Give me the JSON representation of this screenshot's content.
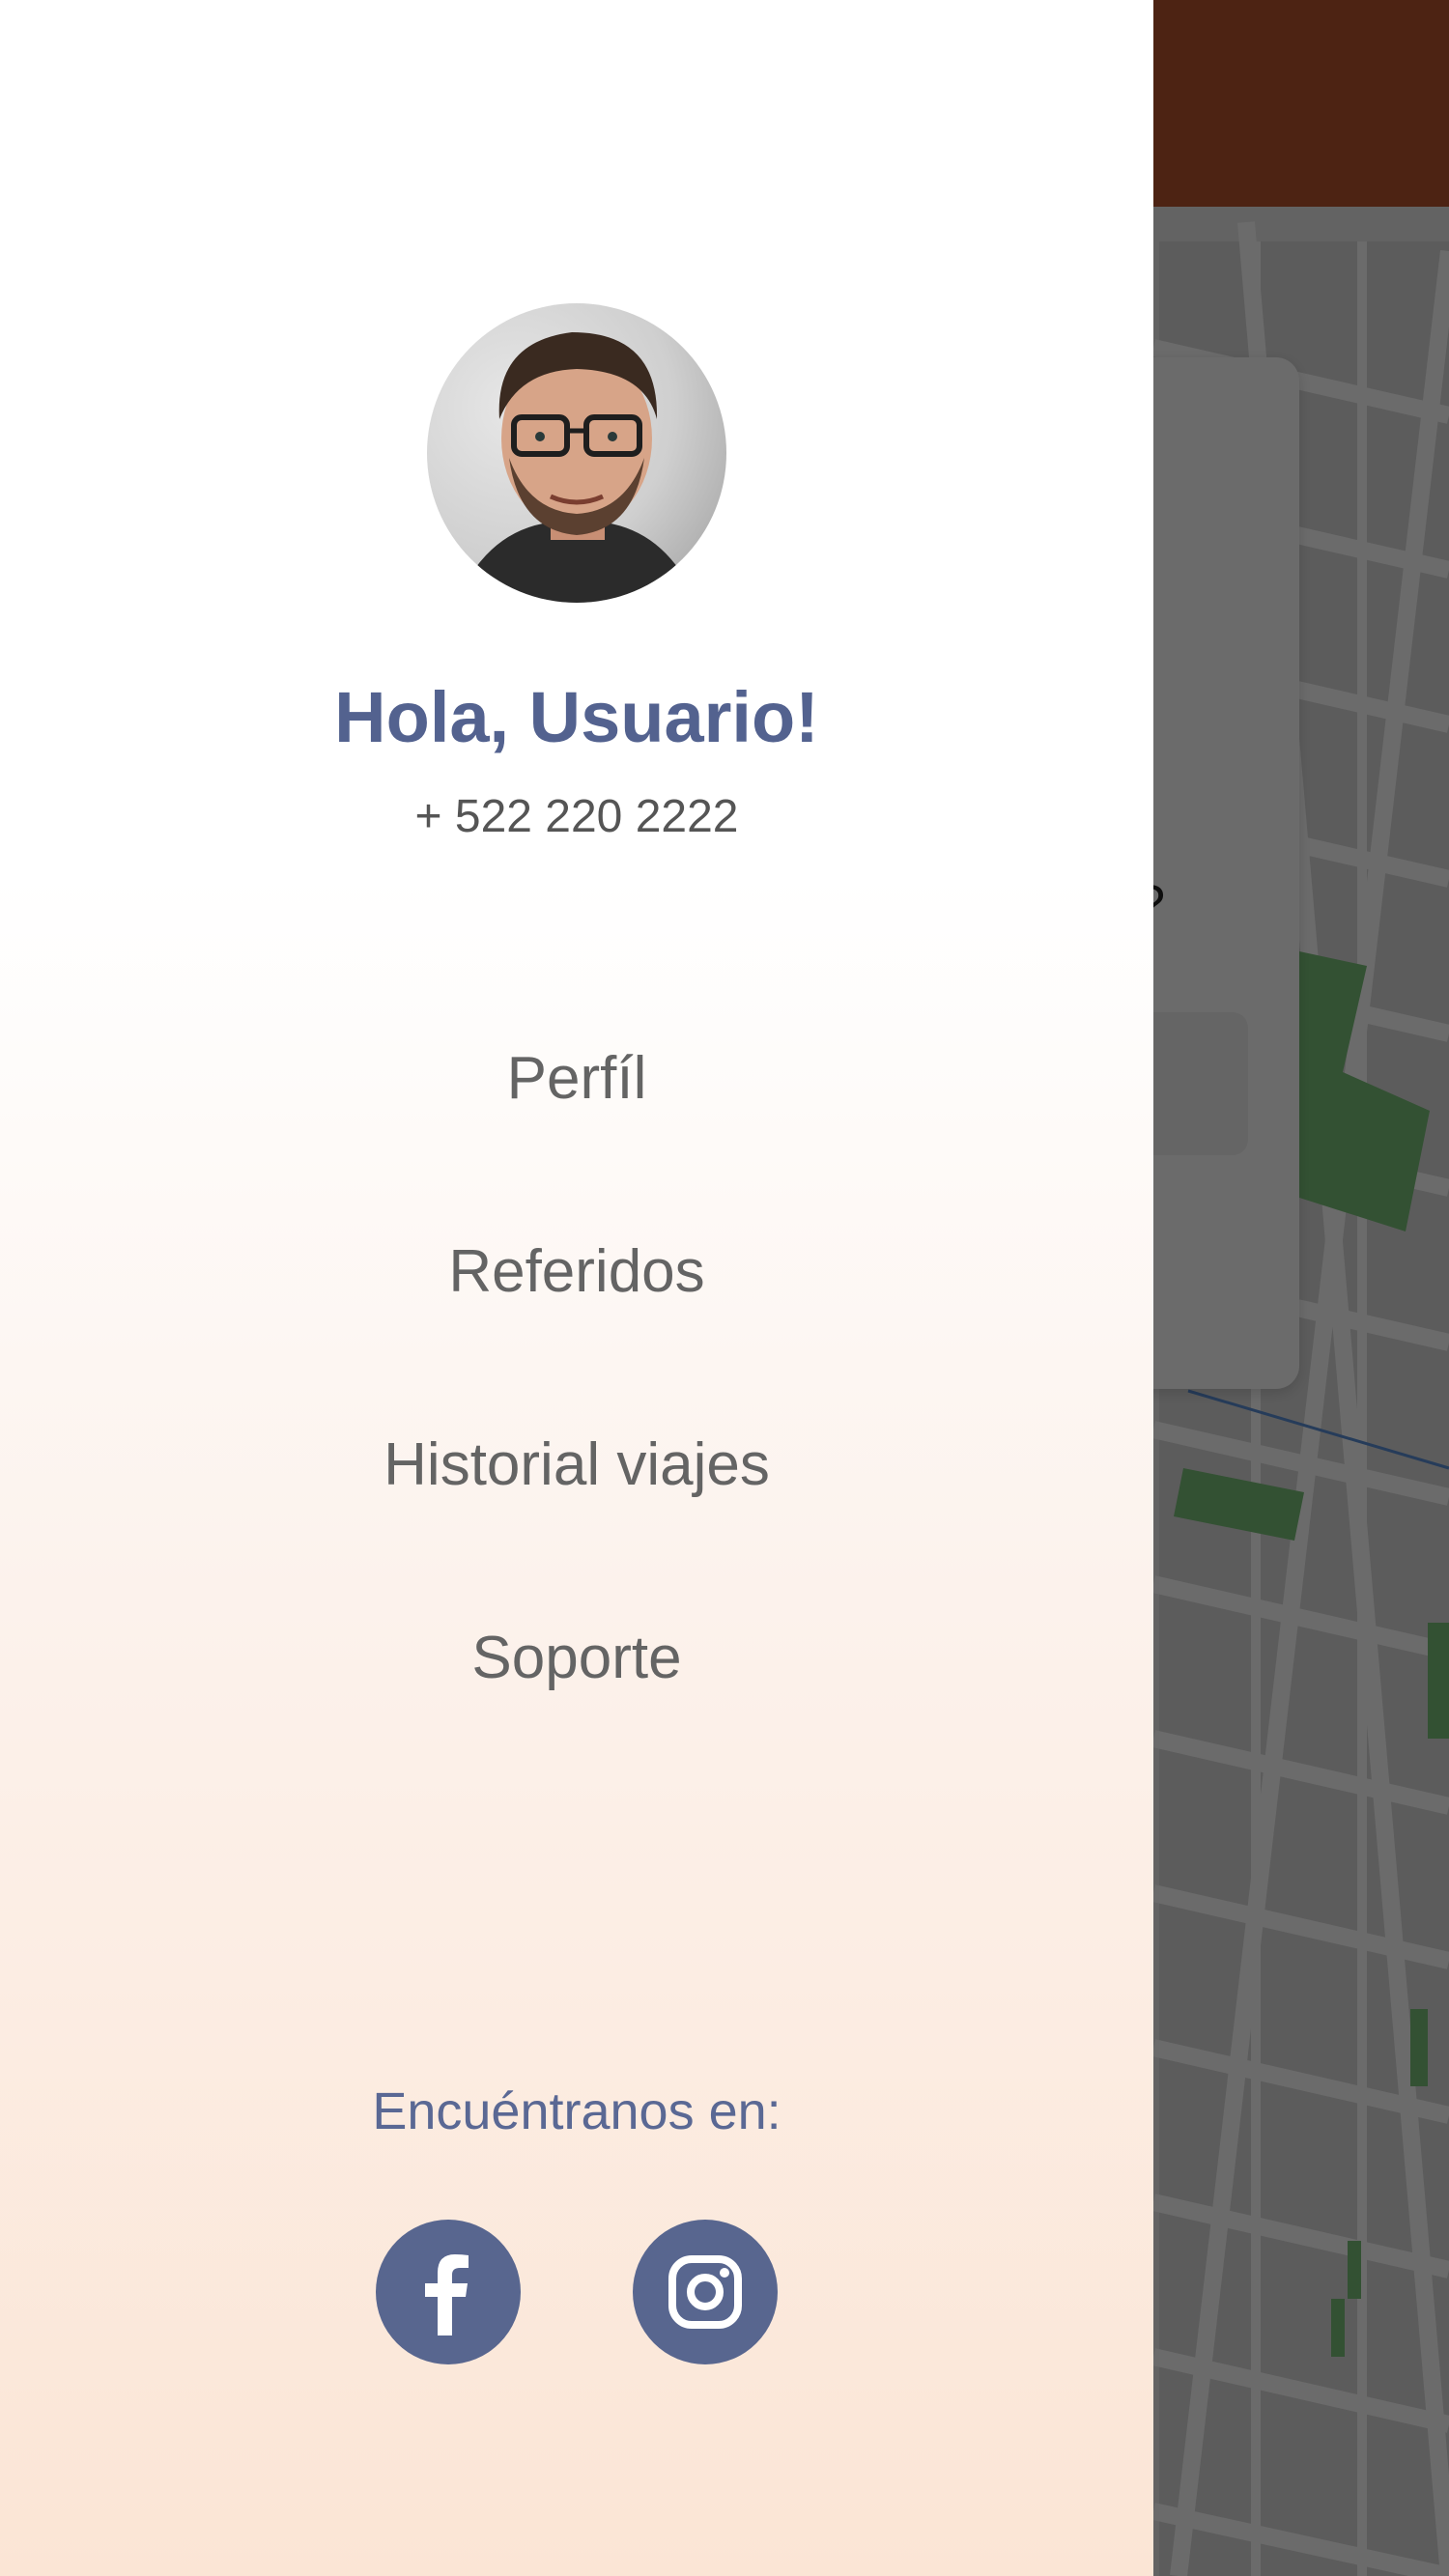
{
  "drawer": {
    "greeting": "Hola, Usuario!",
    "phone": "+ 522 220 2222",
    "menu": [
      {
        "label": "Perfíl",
        "name": "menu-item-perfil"
      },
      {
        "label": "Referidos",
        "name": "menu-item-referidos"
      },
      {
        "label": "Historial viajes",
        "name": "menu-item-historial-viajes"
      },
      {
        "label": "Soporte",
        "name": "menu-item-soporte"
      }
    ],
    "find_us": "Encuéntranos en:",
    "social": [
      {
        "icon": "facebook-icon"
      },
      {
        "icon": "instagram-icon"
      }
    ]
  },
  "background": {
    "partial_text": "?"
  },
  "colors": {
    "accent": "#53628f",
    "social_bg": "#58668f",
    "menu_text": "#646464",
    "top_bar": "#b8532e",
    "gradient_bottom": "#fbe5d5"
  }
}
